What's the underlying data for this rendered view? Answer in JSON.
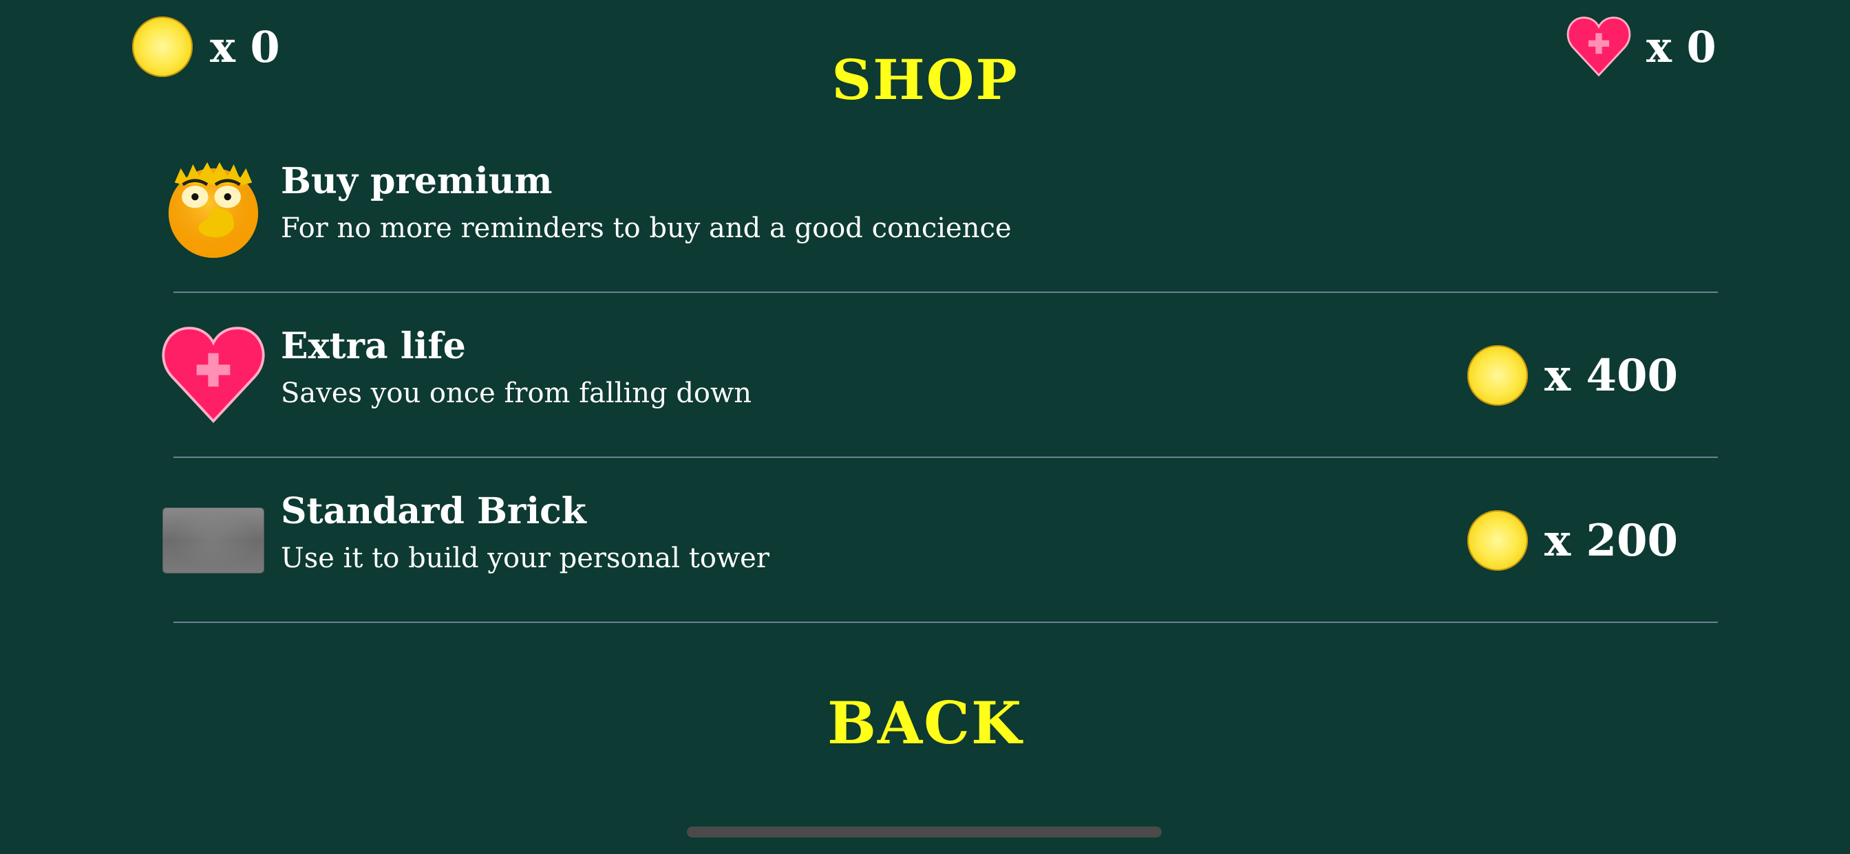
{
  "hud": {
    "coins": {
      "icon": "coin-icon",
      "label": "x 0"
    },
    "lives": {
      "icon": "heart-icon",
      "label": "x 0"
    }
  },
  "shop": {
    "title": "SHOP",
    "items": [
      {
        "icon": "premium-face-icon",
        "title": "Buy premium",
        "description": "For no more reminders to buy and a good concience"
      },
      {
        "icon": "heart-icon",
        "title": "Extra life",
        "description": "Saves you once from falling down",
        "price_icon": "coin-icon",
        "price": "x 400"
      },
      {
        "icon": "brick-icon",
        "title": "Standard Brick",
        "description": "Use it to build your personal tower",
        "price_icon": "coin-icon",
        "price": "x 200"
      }
    ],
    "back_label": "BACK"
  },
  "colors": {
    "background": "#0d3a32",
    "accent_yellow": "#ffff1a",
    "heart_pink": "#ff1f66",
    "divider": "#6f7f9a"
  }
}
